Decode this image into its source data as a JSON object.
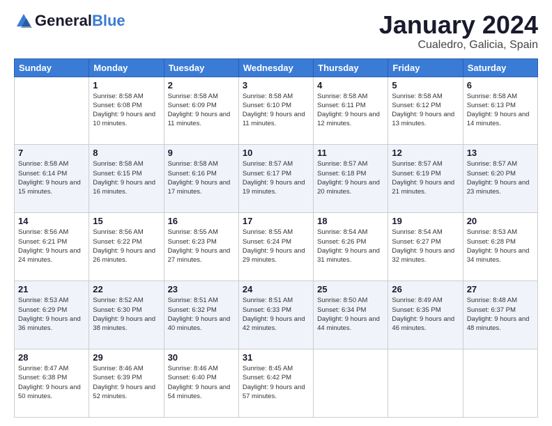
{
  "logo": {
    "general": "General",
    "blue": "Blue"
  },
  "title": {
    "month": "January 2024",
    "location": "Cualedro, Galicia, Spain"
  },
  "days_of_week": [
    "Sunday",
    "Monday",
    "Tuesday",
    "Wednesday",
    "Thursday",
    "Friday",
    "Saturday"
  ],
  "weeks": [
    [
      {
        "day": "",
        "sunrise": "",
        "sunset": "",
        "daylight": ""
      },
      {
        "day": "1",
        "sunrise": "Sunrise: 8:58 AM",
        "sunset": "Sunset: 6:08 PM",
        "daylight": "Daylight: 9 hours and 10 minutes."
      },
      {
        "day": "2",
        "sunrise": "Sunrise: 8:58 AM",
        "sunset": "Sunset: 6:09 PM",
        "daylight": "Daylight: 9 hours and 11 minutes."
      },
      {
        "day": "3",
        "sunrise": "Sunrise: 8:58 AM",
        "sunset": "Sunset: 6:10 PM",
        "daylight": "Daylight: 9 hours and 11 minutes."
      },
      {
        "day": "4",
        "sunrise": "Sunrise: 8:58 AM",
        "sunset": "Sunset: 6:11 PM",
        "daylight": "Daylight: 9 hours and 12 minutes."
      },
      {
        "day": "5",
        "sunrise": "Sunrise: 8:58 AM",
        "sunset": "Sunset: 6:12 PM",
        "daylight": "Daylight: 9 hours and 13 minutes."
      },
      {
        "day": "6",
        "sunrise": "Sunrise: 8:58 AM",
        "sunset": "Sunset: 6:13 PM",
        "daylight": "Daylight: 9 hours and 14 minutes."
      }
    ],
    [
      {
        "day": "7",
        "sunrise": "Sunrise: 8:58 AM",
        "sunset": "Sunset: 6:14 PM",
        "daylight": "Daylight: 9 hours and 15 minutes."
      },
      {
        "day": "8",
        "sunrise": "Sunrise: 8:58 AM",
        "sunset": "Sunset: 6:15 PM",
        "daylight": "Daylight: 9 hours and 16 minutes."
      },
      {
        "day": "9",
        "sunrise": "Sunrise: 8:58 AM",
        "sunset": "Sunset: 6:16 PM",
        "daylight": "Daylight: 9 hours and 17 minutes."
      },
      {
        "day": "10",
        "sunrise": "Sunrise: 8:57 AM",
        "sunset": "Sunset: 6:17 PM",
        "daylight": "Daylight: 9 hours and 19 minutes."
      },
      {
        "day": "11",
        "sunrise": "Sunrise: 8:57 AM",
        "sunset": "Sunset: 6:18 PM",
        "daylight": "Daylight: 9 hours and 20 minutes."
      },
      {
        "day": "12",
        "sunrise": "Sunrise: 8:57 AM",
        "sunset": "Sunset: 6:19 PM",
        "daylight": "Daylight: 9 hours and 21 minutes."
      },
      {
        "day": "13",
        "sunrise": "Sunrise: 8:57 AM",
        "sunset": "Sunset: 6:20 PM",
        "daylight": "Daylight: 9 hours and 23 minutes."
      }
    ],
    [
      {
        "day": "14",
        "sunrise": "Sunrise: 8:56 AM",
        "sunset": "Sunset: 6:21 PM",
        "daylight": "Daylight: 9 hours and 24 minutes."
      },
      {
        "day": "15",
        "sunrise": "Sunrise: 8:56 AM",
        "sunset": "Sunset: 6:22 PM",
        "daylight": "Daylight: 9 hours and 26 minutes."
      },
      {
        "day": "16",
        "sunrise": "Sunrise: 8:55 AM",
        "sunset": "Sunset: 6:23 PM",
        "daylight": "Daylight: 9 hours and 27 minutes."
      },
      {
        "day": "17",
        "sunrise": "Sunrise: 8:55 AM",
        "sunset": "Sunset: 6:24 PM",
        "daylight": "Daylight: 9 hours and 29 minutes."
      },
      {
        "day": "18",
        "sunrise": "Sunrise: 8:54 AM",
        "sunset": "Sunset: 6:26 PM",
        "daylight": "Daylight: 9 hours and 31 minutes."
      },
      {
        "day": "19",
        "sunrise": "Sunrise: 8:54 AM",
        "sunset": "Sunset: 6:27 PM",
        "daylight": "Daylight: 9 hours and 32 minutes."
      },
      {
        "day": "20",
        "sunrise": "Sunrise: 8:53 AM",
        "sunset": "Sunset: 6:28 PM",
        "daylight": "Daylight: 9 hours and 34 minutes."
      }
    ],
    [
      {
        "day": "21",
        "sunrise": "Sunrise: 8:53 AM",
        "sunset": "Sunset: 6:29 PM",
        "daylight": "Daylight: 9 hours and 36 minutes."
      },
      {
        "day": "22",
        "sunrise": "Sunrise: 8:52 AM",
        "sunset": "Sunset: 6:30 PM",
        "daylight": "Daylight: 9 hours and 38 minutes."
      },
      {
        "day": "23",
        "sunrise": "Sunrise: 8:51 AM",
        "sunset": "Sunset: 6:32 PM",
        "daylight": "Daylight: 9 hours and 40 minutes."
      },
      {
        "day": "24",
        "sunrise": "Sunrise: 8:51 AM",
        "sunset": "Sunset: 6:33 PM",
        "daylight": "Daylight: 9 hours and 42 minutes."
      },
      {
        "day": "25",
        "sunrise": "Sunrise: 8:50 AM",
        "sunset": "Sunset: 6:34 PM",
        "daylight": "Daylight: 9 hours and 44 minutes."
      },
      {
        "day": "26",
        "sunrise": "Sunrise: 8:49 AM",
        "sunset": "Sunset: 6:35 PM",
        "daylight": "Daylight: 9 hours and 46 minutes."
      },
      {
        "day": "27",
        "sunrise": "Sunrise: 8:48 AM",
        "sunset": "Sunset: 6:37 PM",
        "daylight": "Daylight: 9 hours and 48 minutes."
      }
    ],
    [
      {
        "day": "28",
        "sunrise": "Sunrise: 8:47 AM",
        "sunset": "Sunset: 6:38 PM",
        "daylight": "Daylight: 9 hours and 50 minutes."
      },
      {
        "day": "29",
        "sunrise": "Sunrise: 8:46 AM",
        "sunset": "Sunset: 6:39 PM",
        "daylight": "Daylight: 9 hours and 52 minutes."
      },
      {
        "day": "30",
        "sunrise": "Sunrise: 8:46 AM",
        "sunset": "Sunset: 6:40 PM",
        "daylight": "Daylight: 9 hours and 54 minutes."
      },
      {
        "day": "31",
        "sunrise": "Sunrise: 8:45 AM",
        "sunset": "Sunset: 6:42 PM",
        "daylight": "Daylight: 9 hours and 57 minutes."
      },
      {
        "day": "",
        "sunrise": "",
        "sunset": "",
        "daylight": ""
      },
      {
        "day": "",
        "sunrise": "",
        "sunset": "",
        "daylight": ""
      },
      {
        "day": "",
        "sunrise": "",
        "sunset": "",
        "daylight": ""
      }
    ]
  ],
  "colors": {
    "header_bg": "#3a7bd5",
    "shaded_row": "#f0f4fa",
    "white_row": "#ffffff"
  }
}
